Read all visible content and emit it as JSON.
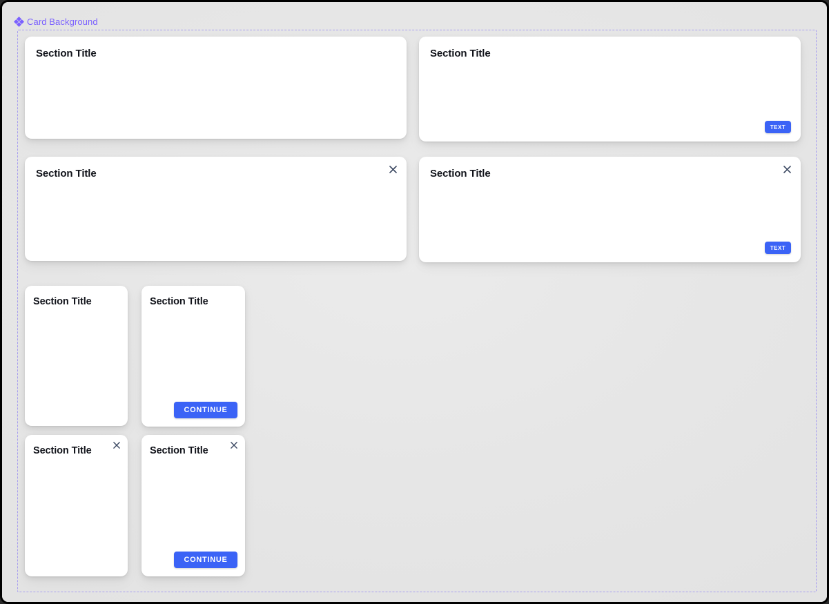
{
  "frame": {
    "label": "Card Background",
    "icon": "component-diamond-icon",
    "accent_color": "#7b61ff",
    "dash_color": "#a79df0",
    "canvas_color": "#e6e6e6"
  },
  "theme": {
    "card_background": "#ffffff",
    "button_blue": "#3b63f6",
    "title_color": "#11131a",
    "close_icon_color": "#3d4a63"
  },
  "cards": [
    {
      "id": "card-large-1",
      "title": "Section Title",
      "has_close": false,
      "button": null,
      "size": "large"
    },
    {
      "id": "card-large-2",
      "title": "Section Title",
      "has_close": false,
      "button": {
        "label": "TEXT",
        "style": "text"
      },
      "size": "large"
    },
    {
      "id": "card-large-3",
      "title": "Section Title",
      "has_close": true,
      "close_label": "×",
      "button": null,
      "size": "large"
    },
    {
      "id": "card-large-4",
      "title": "Section Title",
      "has_close": true,
      "close_label": "×",
      "button": {
        "label": "TEXT",
        "style": "text"
      },
      "size": "large"
    },
    {
      "id": "card-small-1",
      "title": "Section Title",
      "has_close": false,
      "button": null,
      "size": "small"
    },
    {
      "id": "card-small-2",
      "title": "Section Title",
      "has_close": false,
      "button": {
        "label": "CONTINUE",
        "style": "continue"
      },
      "size": "small"
    },
    {
      "id": "card-small-3",
      "title": "Section Title",
      "has_close": true,
      "close_label": "×",
      "button": null,
      "size": "small"
    },
    {
      "id": "card-small-4",
      "title": "Section Title",
      "has_close": true,
      "close_label": "×",
      "button": {
        "label": "CONTINUE",
        "style": "continue"
      },
      "size": "small"
    }
  ]
}
